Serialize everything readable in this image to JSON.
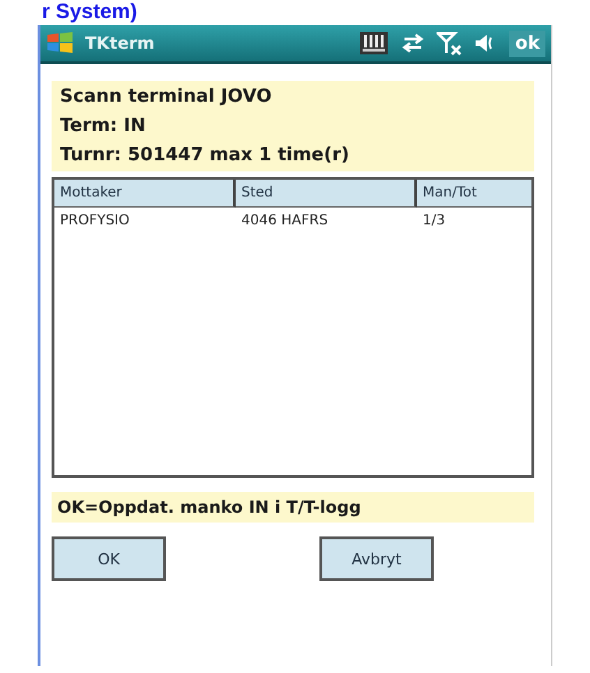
{
  "heading": "r System)",
  "status_bar": {
    "title": "TKterm",
    "ok": "ok"
  },
  "info_lines": [
    "Scann terminal JOVO",
    "Term: IN",
    "Turnr: 501447  max 1 time(r)"
  ],
  "table": {
    "columns": [
      "Mottaker",
      "Sted",
      "Man/Tot"
    ],
    "rows": [
      [
        "PROFYSIO",
        "4046 HAFRS",
        "1/3"
      ]
    ]
  },
  "hint": "OK=Oppdat. manko IN i T/T-logg",
  "buttons": [
    "OK",
    "Avbryt"
  ]
}
